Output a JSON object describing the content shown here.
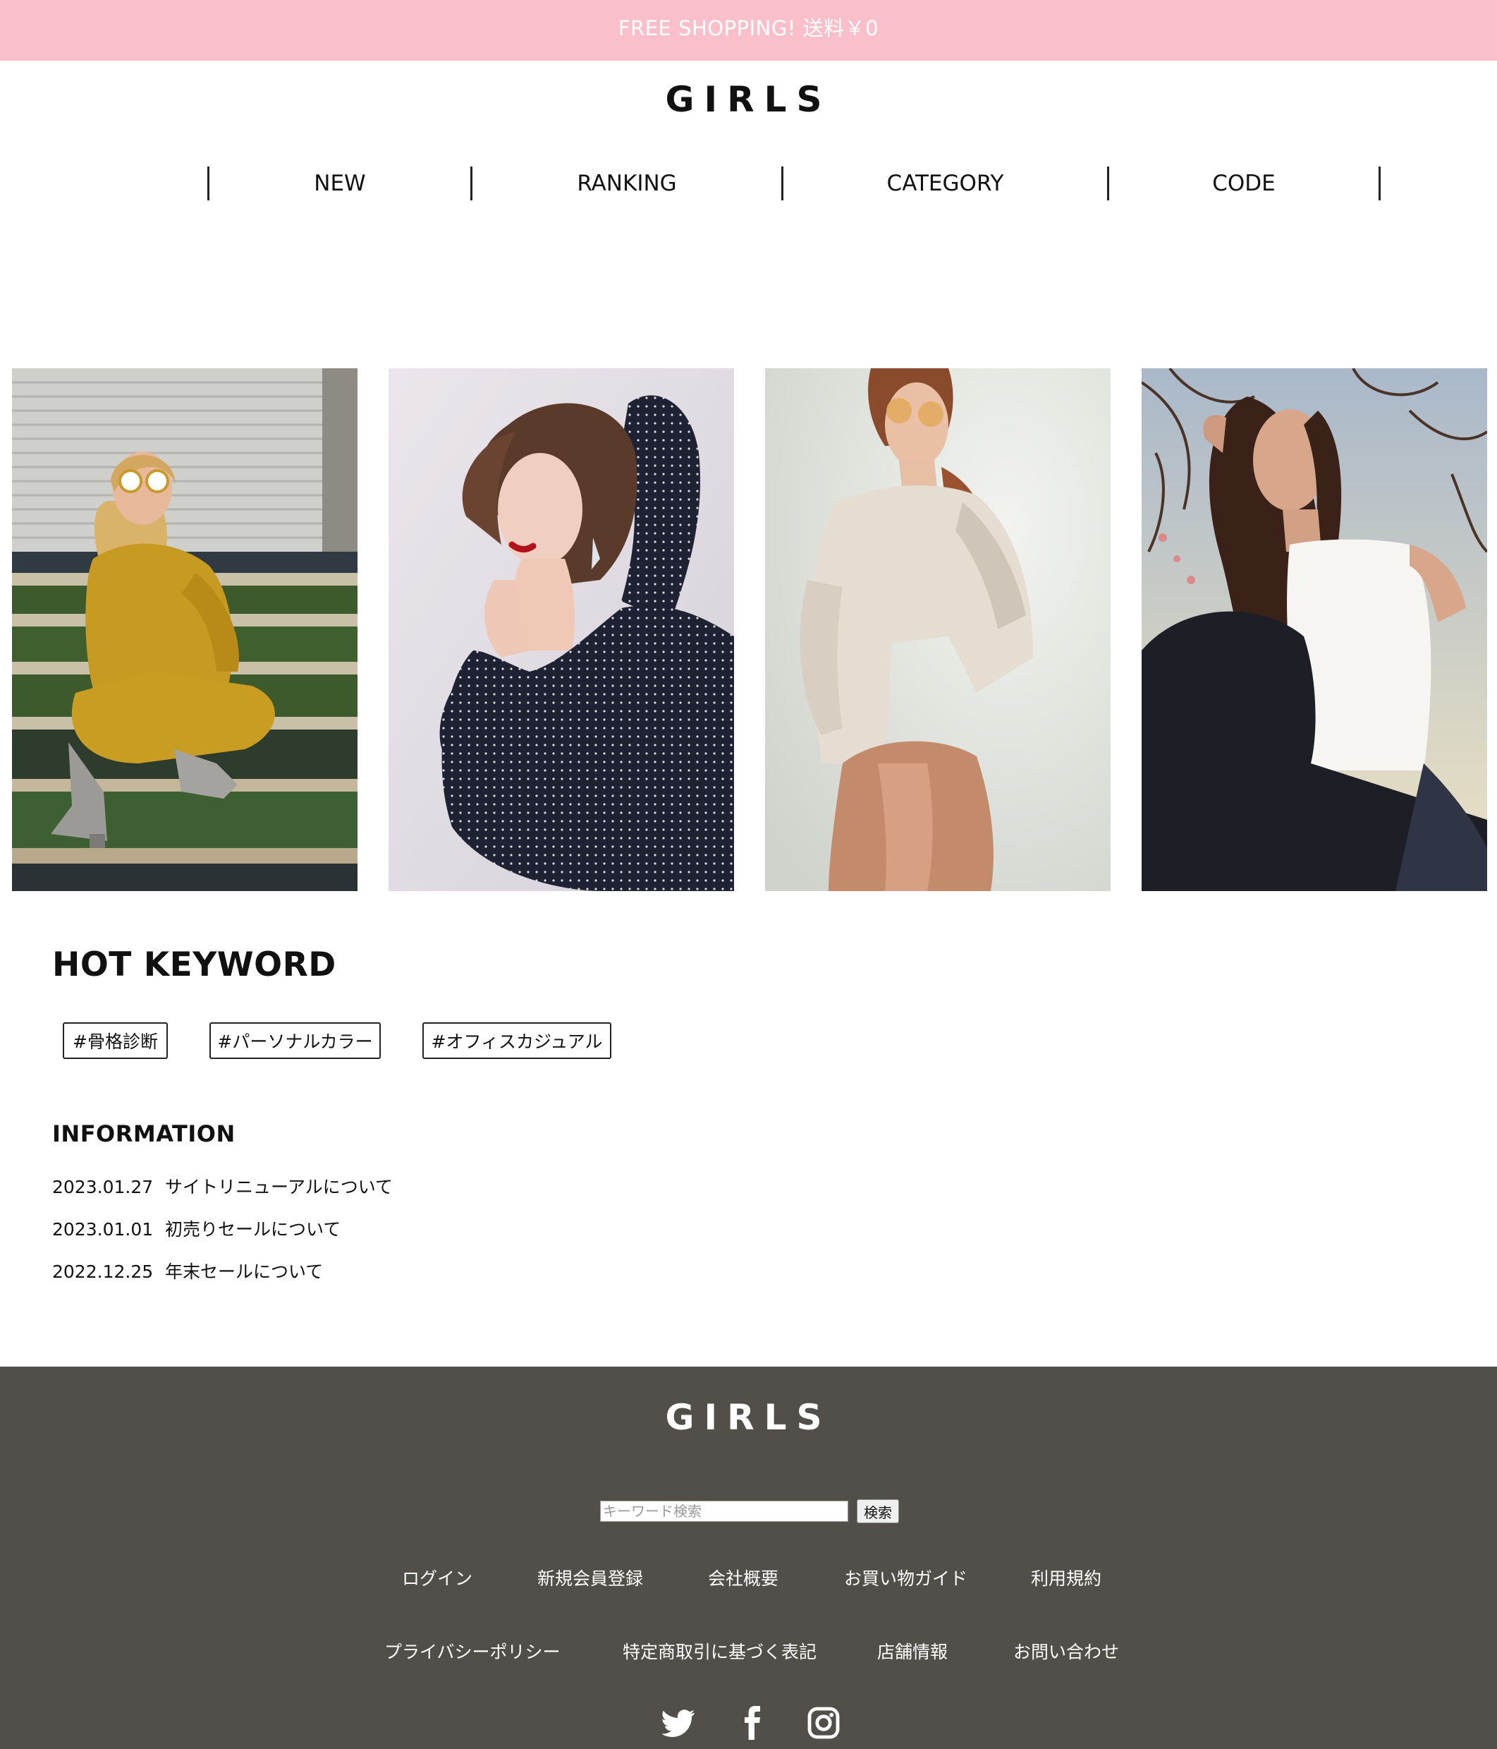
{
  "banner": {
    "text": "FREE SHOPPING! 送料￥0"
  },
  "header": {
    "logo": "GIRLS"
  },
  "nav": {
    "items": [
      "NEW",
      "RANKING",
      "CATEGORY",
      "CODE"
    ]
  },
  "gallery": {
    "photos": [
      {
        "name": "model-yellow-knit-dress"
      },
      {
        "name": "model-polka-dot-blouse"
      },
      {
        "name": "model-beige-shirt-sunglasses"
      },
      {
        "name": "model-white-tank-top"
      }
    ]
  },
  "hot_keyword": {
    "heading": "HOT KEYWORD",
    "tags": [
      "#骨格診断",
      "#パーソナルカラー",
      "#オフィスカジュアル"
    ]
  },
  "information": {
    "heading": "INFORMATION",
    "items": [
      {
        "date": "2023.01.27",
        "title": "サイトリニューアルについて"
      },
      {
        "date": "2023.01.01",
        "title": "初売りセールについて"
      },
      {
        "date": "2022.12.25",
        "title": "年末セールについて"
      }
    ]
  },
  "footer": {
    "logo": "GIRLS",
    "search": {
      "placeholder": "キーワード検索",
      "button": "検索"
    },
    "links_row1": [
      "ログイン",
      "新規会員登録",
      "会社概要",
      "お買い物ガイド",
      "利用規約"
    ],
    "links_row2": [
      "プライバシーポリシー",
      "特定商取引に基づく表記",
      "店舗情報",
      "お問い合わせ"
    ],
    "social": [
      "twitter-icon",
      "facebook-icon",
      "instagram-icon"
    ]
  },
  "colors": {
    "banner_bg": "#f9c0cb",
    "footer_bg": "#524f4a",
    "text": "#111111"
  }
}
